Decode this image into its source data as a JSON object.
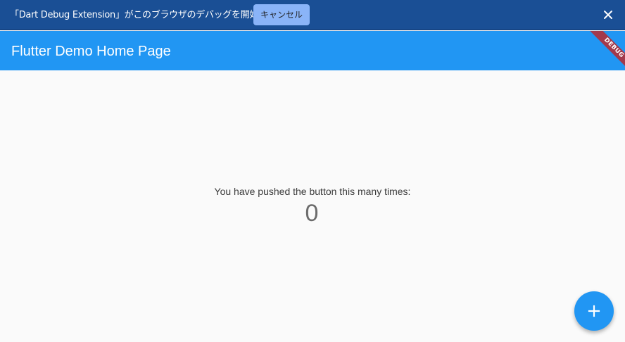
{
  "infobar": {
    "message": "「Dart Debug Extension」がこのブラウザのデバッグを開始しました",
    "cancel_label": "キャンセル",
    "close_icon": "close-icon"
  },
  "appbar": {
    "title": "Flutter Demo Home Page",
    "debug_banner": "DEBUG"
  },
  "main": {
    "counter_label": "You have pushed the button this many times:",
    "counter_value": "0"
  },
  "fab": {
    "icon": "plus-icon"
  },
  "colors": {
    "infobar_bg": "#1a4f95",
    "appbar_bg": "#2196f3",
    "cancel_button_bg": "#8ab4f8",
    "fab_bg": "#2196f3",
    "debug_ribbon": "#a3394c",
    "page_bg": "#fafafa"
  }
}
